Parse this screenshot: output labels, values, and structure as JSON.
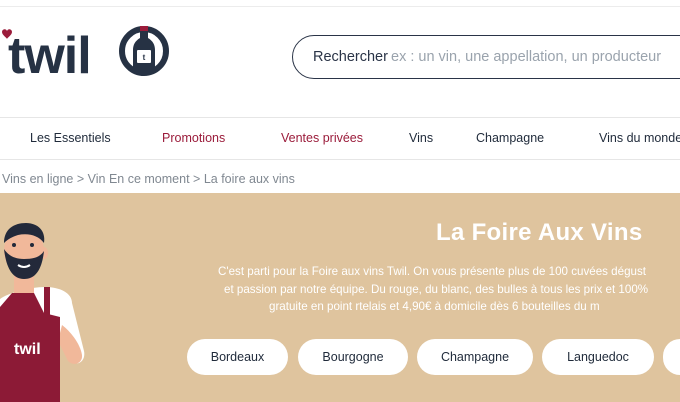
{
  "brand": {
    "logo_text": "twil",
    "colors": {
      "navy": "#1f2a3a",
      "wine": "#9b1c3b",
      "banner": "#dfc49e"
    }
  },
  "search": {
    "label": "Rechercher",
    "placeholder": "ex : un vin, une appellation, un producteur"
  },
  "nav": {
    "items": [
      {
        "label": "Les Essentiels"
      },
      {
        "label": "Promotions"
      },
      {
        "label": "Ventes privées"
      },
      {
        "label": "Vins"
      },
      {
        "label": "Champagne"
      },
      {
        "label": "Vins du monde"
      }
    ]
  },
  "breadcrumb": {
    "items": [
      "Vins en ligne",
      "Vin En ce moment",
      "La foire aux vins"
    ],
    "separator": ">"
  },
  "banner": {
    "title": "La Foire Aux Vins",
    "lines": [
      "C'est parti pour la Foire aux vins Twil. On vous présente plus de 100 cuvées dégust",
      "et passion par notre équipe. Du rouge, du blanc, des bulles à tous les prix et 100%",
      "gratuite en point rtelais et 4,90€ à domicile dès 6 bouteilles du m"
    ],
    "mascot_apron_text": "twil",
    "regions": [
      "Bordeaux",
      "Bourgogne",
      "Champagne",
      "Languedoc",
      ""
    ]
  }
}
